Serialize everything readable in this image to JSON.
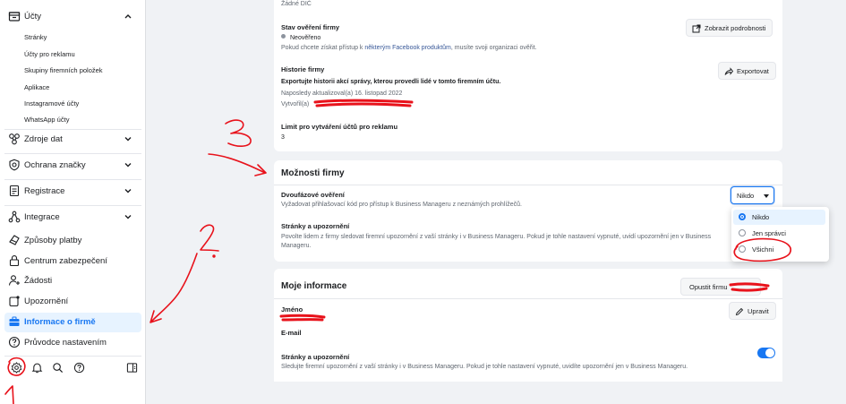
{
  "sidebar": {
    "accounts": {
      "label": "Účty",
      "icon": "folder-icon"
    },
    "sub_items": [
      "Stránky",
      "Účty pro reklamu",
      "Skupiny firemních položek",
      "Aplikace",
      "Instagramové účty",
      "WhatsApp účty"
    ],
    "items": [
      {
        "label": "Zdroje dat",
        "icon": "data-sources-icon"
      },
      {
        "label": "Ochrana značky",
        "icon": "shield-icon"
      },
      {
        "label": "Registrace",
        "icon": "registration-icon"
      },
      {
        "label": "Integrace",
        "icon": "integrations-icon"
      },
      {
        "label": "Způsoby platby",
        "icon": "payment-icon"
      },
      {
        "label": "Centrum zabezpečení",
        "icon": "lock-icon"
      },
      {
        "label": "Žádosti",
        "icon": "requests-icon"
      },
      {
        "label": "Upozornění",
        "icon": "notifications-icon"
      },
      {
        "label": "Informace o firmě",
        "icon": "briefcase-icon"
      },
      {
        "label": "Průvodce nastavením",
        "icon": "help-icon"
      }
    ],
    "bottom_icons": [
      "settings-icon",
      "bell-icon",
      "search-icon",
      "question-icon",
      "panel-toggle-icon"
    ]
  },
  "business_info": {
    "top_cut_text": "Žádné DIČ",
    "verification": {
      "label": "Stav ověření firmy",
      "status": "Neověřeno",
      "hint_before": "Pokud chcete získat přístup k ",
      "hint_link": "některým Facebook produktům",
      "hint_after": ", musíte svoji organizaci ověřit.",
      "button": "Zobrazit podrobnosti"
    },
    "history": {
      "label": "Historie firmy",
      "subtitle": "Exportujte historii akcí správy, kterou provedli lidé v tomto firemním účtu.",
      "updated": "Naposledy aktualizoval(a) 16. listopad 2022",
      "created": "Vytvořil(a)",
      "button": "Exportovat"
    },
    "limit": {
      "label": "Limit pro vytváření účtů pro reklamu",
      "value": "3"
    }
  },
  "business_options": {
    "title": "Možnosti firmy",
    "two_factor": {
      "label": "Dvoufázové ověření",
      "description": "Vyžadovat přihlašovací kód pro přístup k Business Manageru z neznámých prohlížečů.",
      "selected": "Nikdo",
      "options": [
        "Nikdo",
        "Jen správci",
        "Všichni"
      ]
    },
    "pages": {
      "label": "Stránky a upozornění",
      "description_line1": "Povolte lidem z firmy sledovat firemní upozornění z vaší stránky i v Business Manageru. Pokud je tohle nastavení vypnuté, uvidí upozornění jen v Business",
      "description_line2": "Manageru."
    }
  },
  "my_info": {
    "title": "Moje informace",
    "leave_button": "Opustit firmu",
    "edit_button": "Upravit",
    "name_label": "Jméno",
    "email_label": "E-mail",
    "pages_label": "Stránky a upozornění",
    "pages_description": "Sledujte firemní upozornění z vaší stránky i v Business Manageru. Pokud je tohle nastavení vypnuté, uvidíte upozornění jen v Business Manageru.",
    "pages_toggle_on": true
  },
  "annotations": {
    "step1": "1",
    "step2": "2.",
    "step3": "3"
  },
  "colors": {
    "accent": "#1877f2",
    "annotation_red": "#e8121b"
  }
}
